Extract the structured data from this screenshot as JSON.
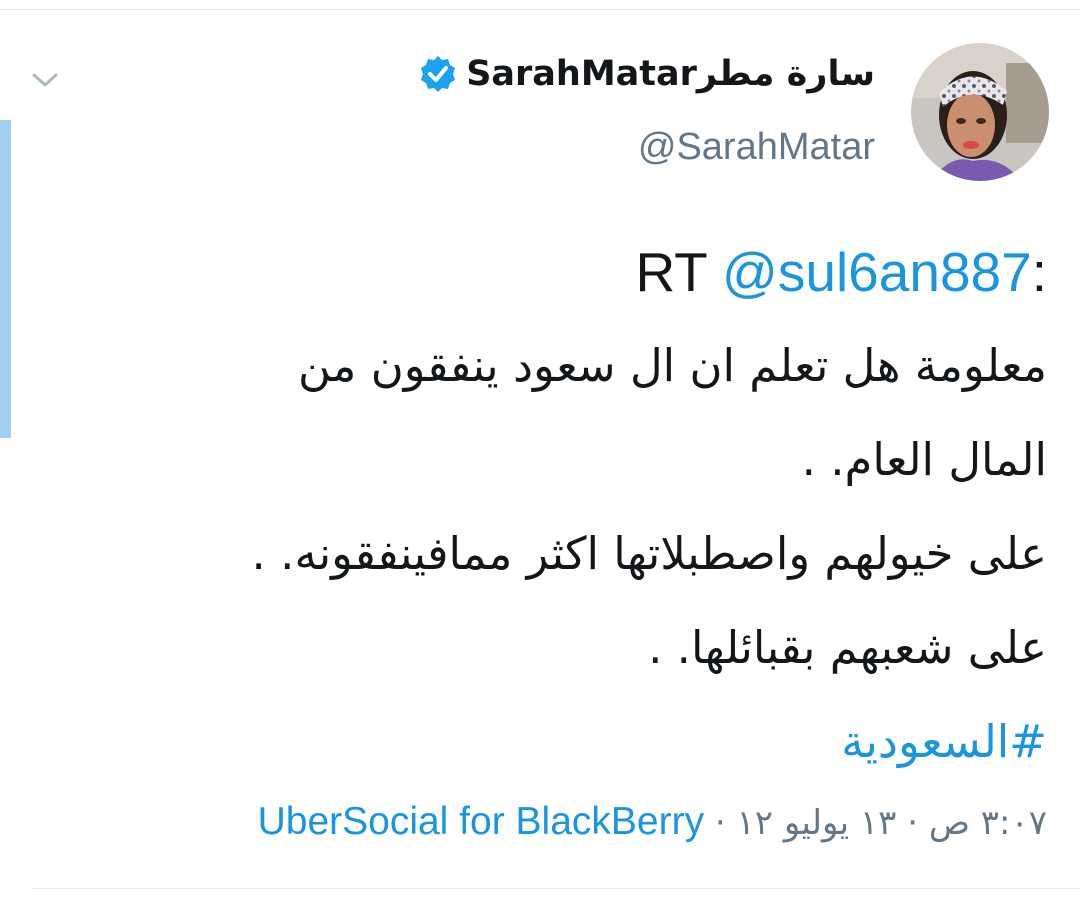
{
  "tweet": {
    "user": {
      "display_name": "سارة مطرSarahMatar",
      "handle": "@SarahMatar",
      "verified": true,
      "avatar_icon": "profile-photo-avatar"
    },
    "text": {
      "rt_prefix": "RT",
      "mention": "@sul6an887",
      "rt_colon": ":",
      "line_1": "معلومة هل تعلم ان ال سعود ينفقون من",
      "line_2": "المال العام. .",
      "line_3": "على خيولهم واصطبلاتها اكثر ممافينفقونه. .",
      "line_4": "على شعبهم بقبائلها. .",
      "hashtag": "#السعودية"
    },
    "meta": {
      "timestamp": "٣:٠٧ ص · ١٣ يوليو ١٢",
      "separator": "·",
      "source": "UberSocial for BlackBerry"
    },
    "icons": {
      "menu": "chevron-down-icon",
      "verified": "verified-badge-icon"
    },
    "colors": {
      "link": "#1b95e0",
      "secondary_text": "#657786",
      "primary_text": "#14171a",
      "verified_badge": "#1da1f2",
      "thread_bar": "#9fd0f2",
      "divider": "#e6ecf0"
    }
  }
}
